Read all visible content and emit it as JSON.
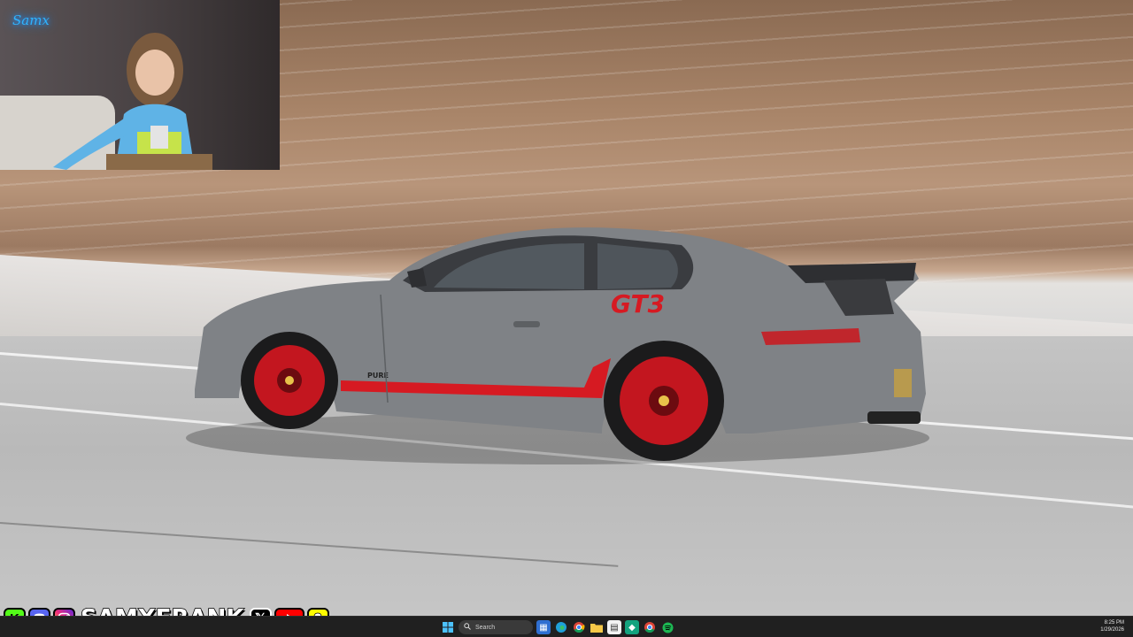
{
  "overlay": {
    "neon_sign": "Samx",
    "handle": "SAMXFRANK",
    "social_icons": [
      "kick-icon",
      "discord-icon",
      "instagram-icon",
      "x-icon",
      "youtube-icon",
      "snapchat-icon"
    ],
    "colors": {
      "kick": "#53fc18",
      "discord": "#5865f2",
      "instagram": "#d62976",
      "x": "#000000",
      "youtube": "#ff0000",
      "snapchat": "#fffc00"
    }
  },
  "wallpaper": {
    "car_decal": "GT3",
    "side_badge": "PURE",
    "colors": {
      "car_body": "#7e8184",
      "accent_red": "#d61a22"
    }
  },
  "taskbar": {
    "search_placeholder": "Search",
    "time": "8:25 PM",
    "date": "1/29/2026"
  }
}
